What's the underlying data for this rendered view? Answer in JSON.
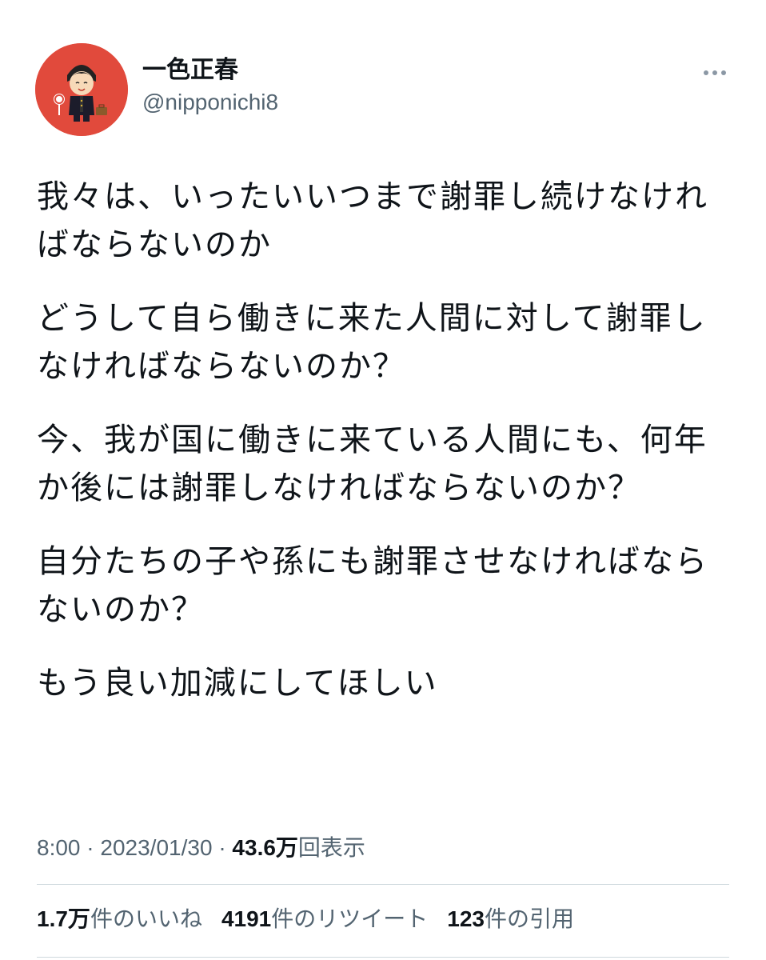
{
  "author": {
    "display_name": "一色正春",
    "handle": "@nipponichi8",
    "avatar_label": "masa-chanrio",
    "avatar_color": "#e14a3c"
  },
  "menu": {
    "icon": "more-horizontal-icon"
  },
  "tweet": {
    "paragraphs": [
      "我々は、いったいいつまで謝罪し続けなければならないのか",
      "どうして自ら働きに来た人間に対して謝罪しなければならないのか？",
      "今、我が国に働きに来ている人間にも、何年か後には謝罪しなければならないのか？",
      "自分たちの子や孫にも謝罪させなければならないのか？",
      "もう良い加減にしてほしい"
    ],
    "time": "8:00",
    "date": "2023/01/30",
    "separator": "·",
    "views_count": "43.6万",
    "views_label": "回表示"
  },
  "stats": {
    "likes_count": "1.7万",
    "likes_label": "件のいいね",
    "retweets_count": "4191",
    "retweets_label": "件のリツイート",
    "quotes_count": "123",
    "quotes_label": "件の引用"
  }
}
